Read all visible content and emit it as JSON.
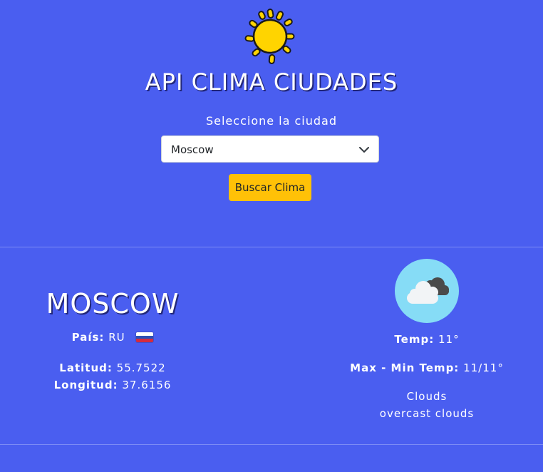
{
  "header": {
    "title": "API CLIMA CIUDADES",
    "select_label": "Seleccione la ciudad",
    "selected_city": "Moscow",
    "search_button": "Buscar Clima"
  },
  "location": {
    "city": "MOSCOW",
    "country_label": "País:",
    "country_code": "RU",
    "latitude_label": "Latitud:",
    "latitude": "55.7522",
    "longitude_label": "Longitud:",
    "longitude": "37.6156"
  },
  "weather": {
    "temp_label": "Temp:",
    "temp": "11°",
    "minmax_label": "Max - Min Temp:",
    "minmax": "11/11°",
    "main": "Clouds",
    "description": "overcast clouds",
    "icon": "cloud-icon"
  },
  "colors": {
    "background": "#4a5ef0",
    "button": "#ffc107",
    "sun": "#ffd400",
    "icon_bg": "#86dcf6"
  }
}
